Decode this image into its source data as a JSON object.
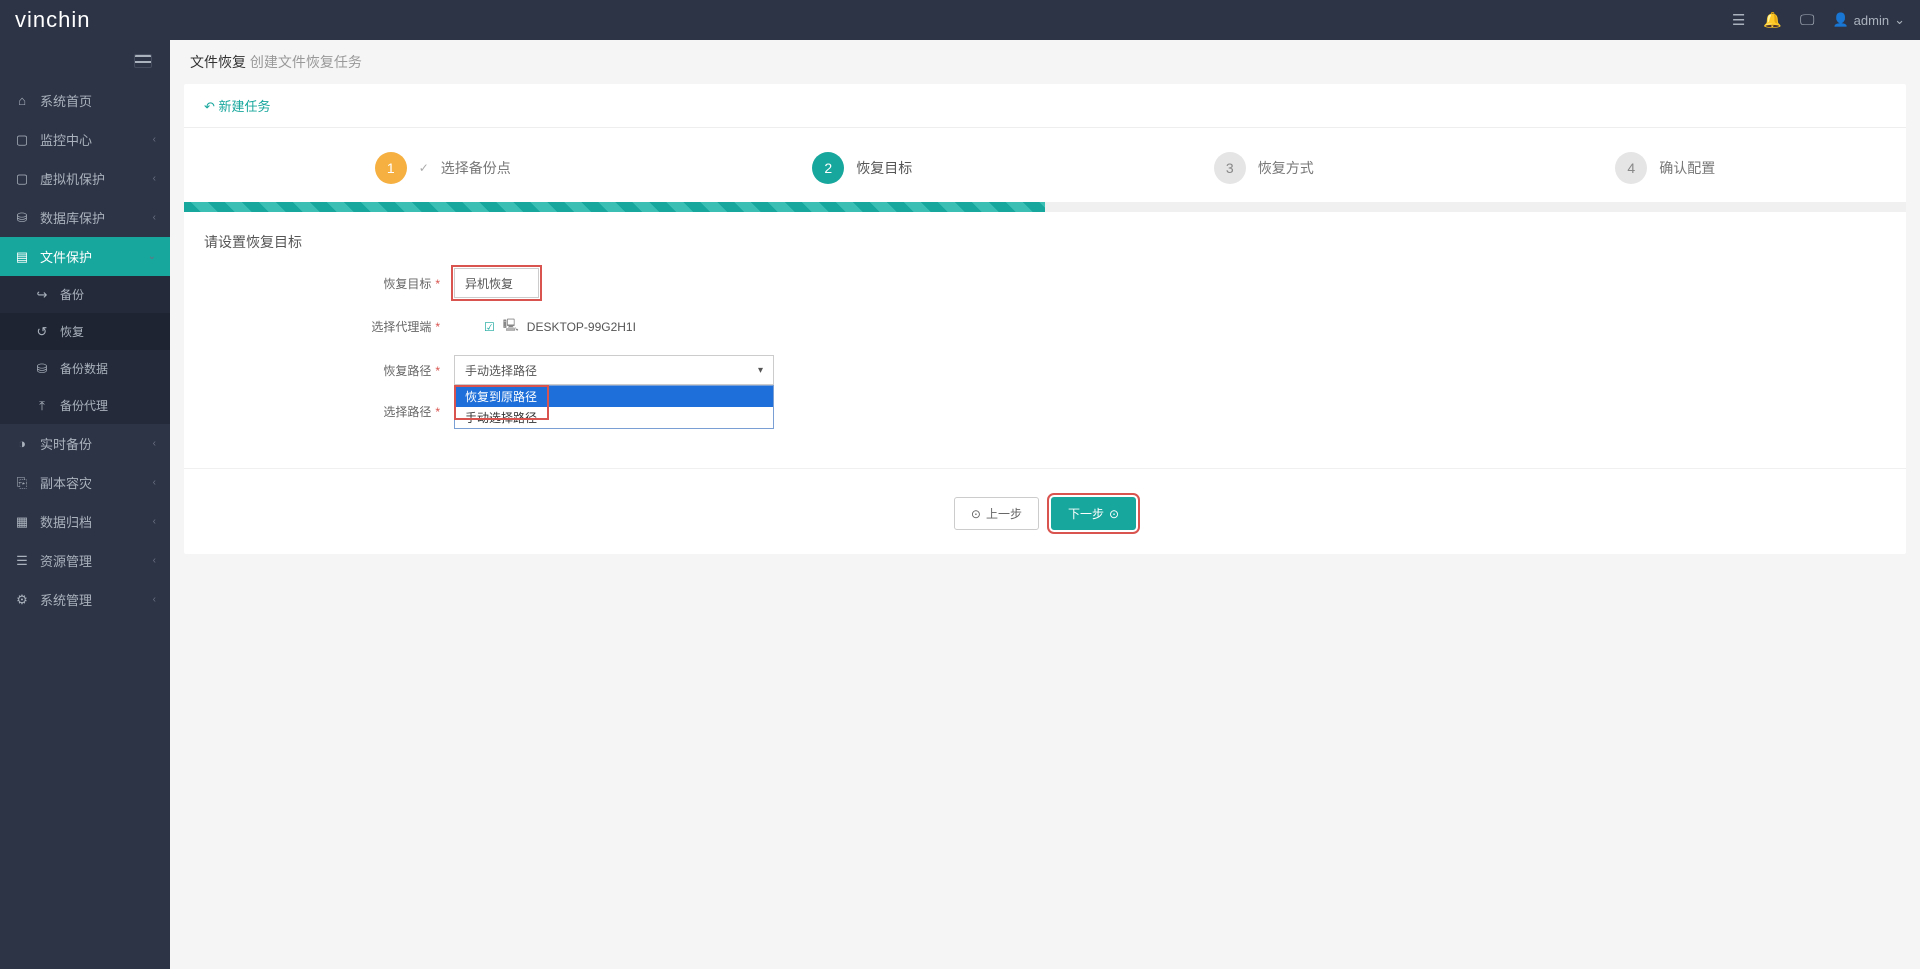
{
  "header": {
    "logo": "vinchin",
    "user": "admin"
  },
  "sidebar": {
    "items": [
      {
        "label": "系统首页",
        "icon": "⌂"
      },
      {
        "label": "监控中心",
        "icon": "▢",
        "caret": true
      },
      {
        "label": "虚拟机保护",
        "icon": "▢",
        "caret": true
      },
      {
        "label": "数据库保护",
        "icon": "⛁",
        "caret": true
      },
      {
        "label": "文件保护",
        "icon": "▤",
        "caret": true,
        "active": true
      },
      {
        "label": "实时备份",
        "icon": "◑",
        "caret": true
      },
      {
        "label": "副本容灾",
        "icon": "⎘",
        "caret": true
      },
      {
        "label": "数据归档",
        "icon": "▦",
        "caret": true
      },
      {
        "label": "资源管理",
        "icon": "☰",
        "caret": true
      },
      {
        "label": "系统管理",
        "icon": "⚙",
        "caret": true
      }
    ],
    "sub": [
      {
        "label": "备份",
        "icon": "↪"
      },
      {
        "label": "恢复",
        "icon": "↺",
        "active": true
      },
      {
        "label": "备份数据",
        "icon": "⛁"
      },
      {
        "label": "备份代理",
        "icon": "⤒"
      }
    ]
  },
  "breadcrumb": {
    "primary": "文件恢复",
    "secondary": "创建文件恢复任务"
  },
  "panel": {
    "new_task": "新建任务"
  },
  "steps": [
    {
      "num": "1",
      "label": "选择备份点",
      "state": "done"
    },
    {
      "num": "2",
      "label": "恢复目标",
      "state": "current"
    },
    {
      "num": "3",
      "label": "恢复方式",
      "state": "pending"
    },
    {
      "num": "4",
      "label": "确认配置",
      "state": "pending"
    }
  ],
  "form": {
    "title": "请设置恢复目标",
    "target_label": "恢复目标",
    "target_value": "异机恢复",
    "agent_label": "选择代理端",
    "agent_value": "DESKTOP-99G2H1I",
    "path_label": "恢复路径",
    "path_value": "手动选择路径",
    "select_path_label": "选择路径",
    "dropdown": [
      {
        "label": "恢复到原路径",
        "hl": true
      },
      {
        "label": "手动选择路径",
        "hl": false
      }
    ]
  },
  "buttons": {
    "prev": "上一步",
    "next": "下一步"
  }
}
